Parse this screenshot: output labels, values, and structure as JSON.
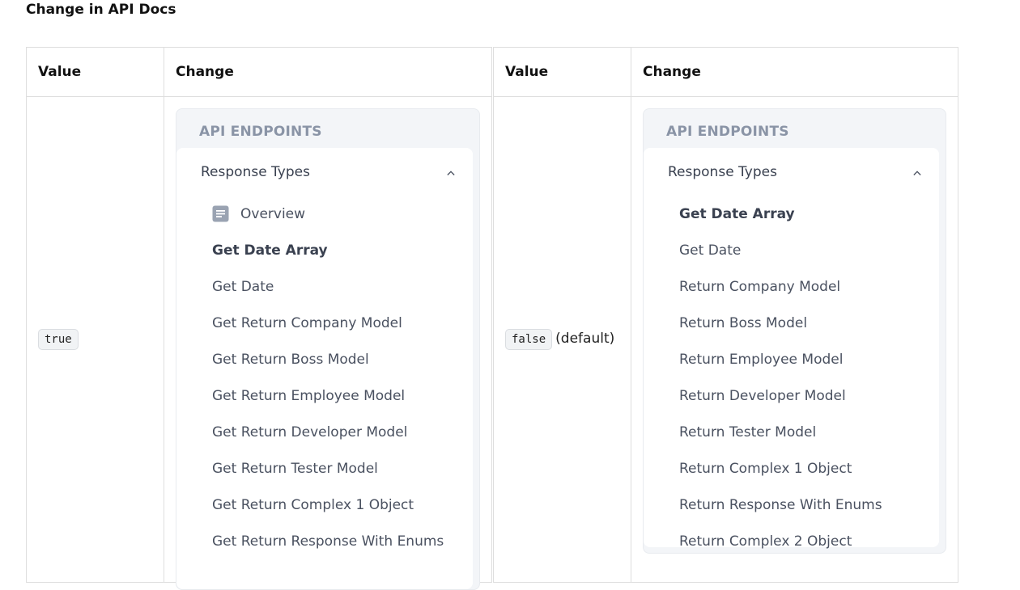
{
  "page": {
    "heading": "Change in API Docs"
  },
  "left": {
    "header_value": "Value",
    "header_change": "Change",
    "value": "true",
    "panel": {
      "section_title": "API ENDPOINTS",
      "group_label": "Response Types",
      "overview_label": "Overview",
      "items": [
        "Get Date Array",
        "Get Date",
        "Get Return Company Model",
        "Get Return Boss Model",
        "Get Return Employee Model",
        "Get Return Developer Model",
        "Get Return Tester Model",
        "Get Return Complex 1 Object",
        "Get Return Response With Enums"
      ]
    }
  },
  "right": {
    "header_value": "Value",
    "header_change": "Change",
    "value": "false",
    "value_suffix": "(default)",
    "panel": {
      "section_title": "API ENDPOINTS",
      "group_label": "Response Types",
      "items": [
        "Get Date Array",
        "Get Date",
        "Return Company Model",
        "Return Boss Model",
        "Return Employee Model",
        "Return Developer Model",
        "Return Tester Model",
        "Return Complex 1 Object",
        "Return Response With Enums",
        "Return Complex 2 Object"
      ]
    }
  }
}
